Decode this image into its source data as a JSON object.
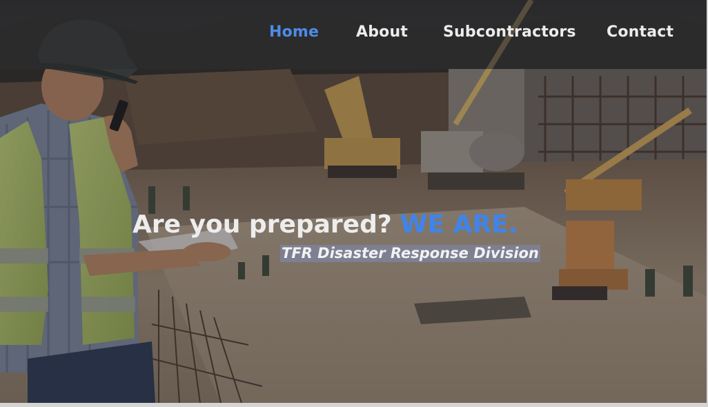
{
  "nav": {
    "items": [
      {
        "label": "Home",
        "active": true
      },
      {
        "label": "About",
        "active": false
      },
      {
        "label": "Subcontractors",
        "active": false
      },
      {
        "label": "Contact",
        "active": false
      }
    ]
  },
  "hero": {
    "headline": "Are you prepared?",
    "headline_accent": "WE ARE.",
    "tagline": "TFR Disaster Response Division",
    "image": "construction-site-worker-photo"
  },
  "colors": {
    "accent": "#3f84ea",
    "nav_active": "#4f8be6",
    "nav_text": "#ececec",
    "headline_text": "#ededed"
  }
}
